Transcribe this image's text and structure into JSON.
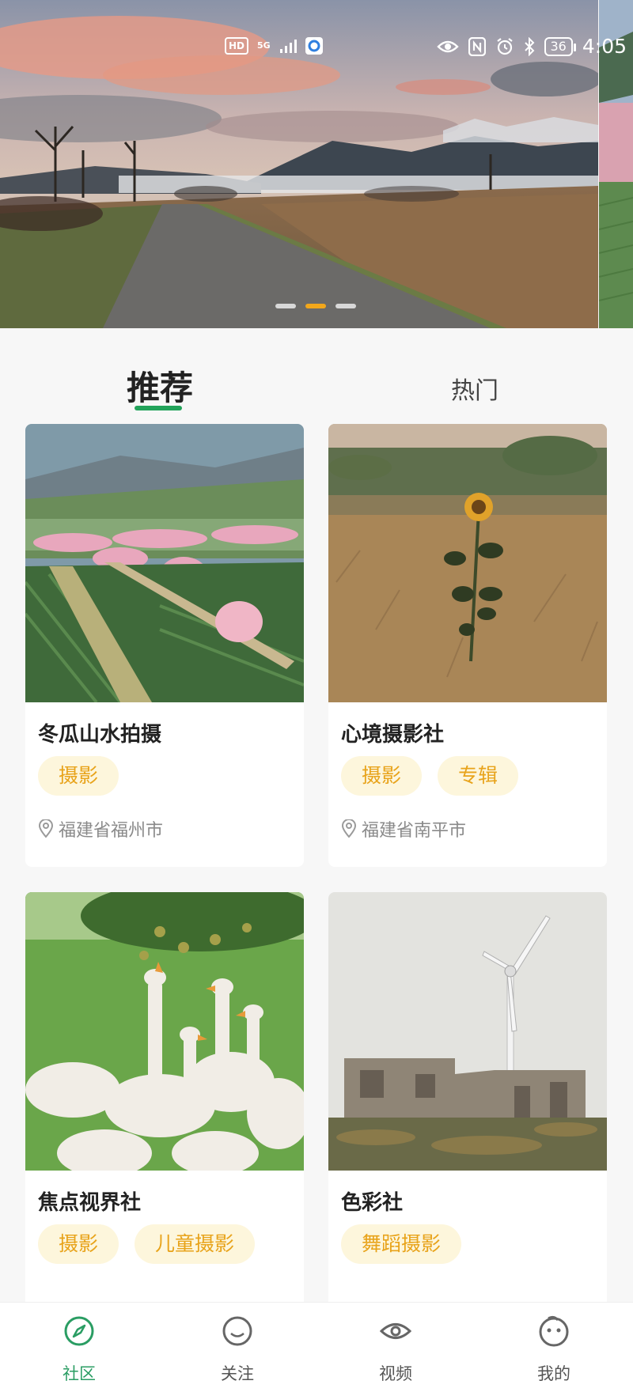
{
  "status_bar": {
    "left_chips": [
      "HD",
      "5G"
    ],
    "battery": "36",
    "time": "4:05"
  },
  "banner": {
    "page_count": 3,
    "active_index": 1
  },
  "tabs": [
    {
      "label": "推荐",
      "active": true
    },
    {
      "label": "热门",
      "active": false
    }
  ],
  "cards": [
    {
      "title": "冬瓜山水拍摄",
      "tags": [
        "摄影"
      ],
      "location": "福建省福州市",
      "photo": "cherry-blossom-tea-fields"
    },
    {
      "title": "心境摄影社",
      "tags": [
        "摄影",
        "专辑"
      ],
      "location": "福建省南平市",
      "photo": "sunflower-field"
    },
    {
      "title": "焦点视界社",
      "tags": [
        "摄影",
        "儿童摄影"
      ],
      "location": "",
      "photo": "white-geese-on-grass"
    },
    {
      "title": "色彩社",
      "tags": [
        "舞蹈摄影"
      ],
      "location": "",
      "photo": "wind-turbine-ruins"
    }
  ],
  "bottom_nav": [
    {
      "label": "社区",
      "icon": "compass-icon",
      "active": true
    },
    {
      "label": "关注",
      "icon": "smiley-icon",
      "active": false
    },
    {
      "label": "视频",
      "icon": "eye-icon",
      "active": false
    },
    {
      "label": "我的",
      "icon": "face-icon",
      "active": false
    }
  ],
  "colors": {
    "accent_green": "#2a9d63",
    "tag_bg": "#fdf6dc",
    "tag_text": "#e8a31a",
    "dot_active": "#f2a71b"
  }
}
